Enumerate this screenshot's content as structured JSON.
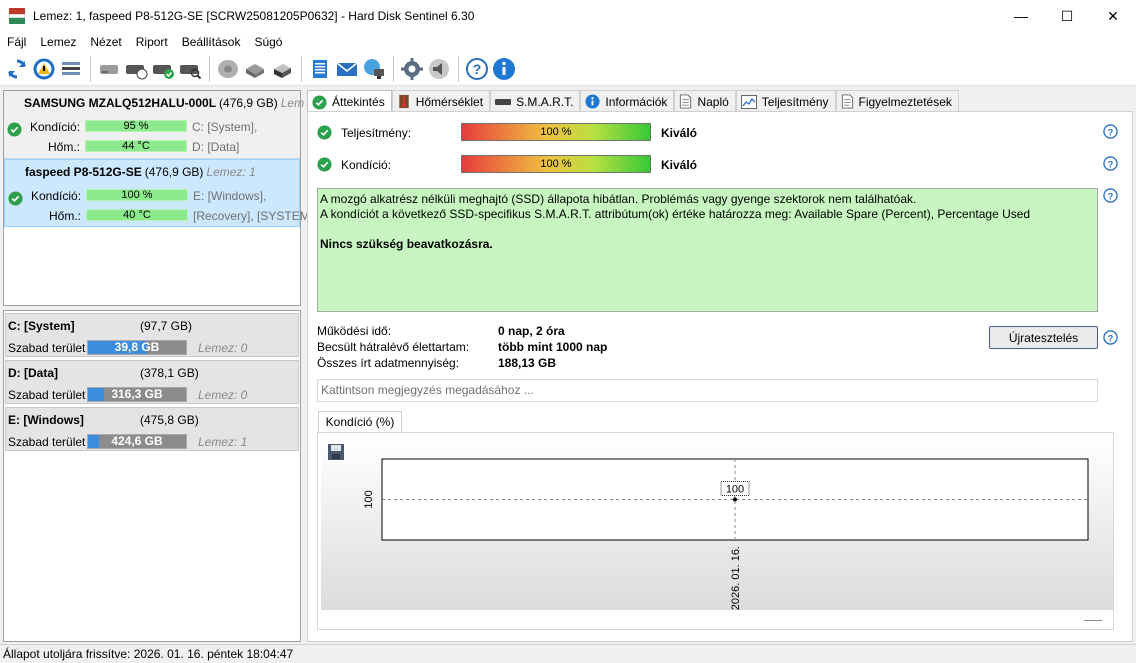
{
  "window": {
    "title": "Lemez: 1, faspeed P8-512G-SE [SCRW25081205P0632]  -  Hard Disk Sentinel 6.30",
    "minimize": "—",
    "maximize": "☐",
    "close": "✕"
  },
  "menu": [
    "Fájl",
    "Lemez",
    "Nézet",
    "Riport",
    "Beállítások",
    "Súgó"
  ],
  "disks": [
    {
      "name": "SAMSUNG MZALQ512HALU-000L",
      "size": "(476,9 GB)",
      "lemez": "Lem",
      "health_label": "Kondíció:",
      "health_value": "95 %",
      "health_fraction": 0.95,
      "temp_label": "Hőm.:",
      "temp_value": "44 °C",
      "part1": "C: [System],",
      "part2": "D: [Data]"
    },
    {
      "name": "faspeed P8-512G-SE",
      "size": "(476,9 GB)",
      "lemez": "Lemez: 1",
      "health_label": "Kondíció:",
      "health_value": "100 %",
      "health_fraction": 1.0,
      "temp_label": "Hőm.:",
      "temp_value": "40 °C",
      "part1": "E: [Windows],",
      "part2": "[Recovery],  [SYSTEM"
    }
  ],
  "volumes": [
    {
      "name": "C: [System]",
      "size": "(97,7 GB)",
      "free_label": "Szabad terület",
      "free": "39,8 GB",
      "used_fraction": 0.6,
      "lemez": "Lemez: 0"
    },
    {
      "name": "D: [Data]",
      "size": "(378,1 GB)",
      "free_label": "Szabad terület",
      "free": "316,3 GB",
      "used_fraction": 0.16,
      "lemez": "Lemez: 0"
    },
    {
      "name": "E: [Windows]",
      "size": "(475,8 GB)",
      "free_label": "Szabad terület",
      "free": "424,6 GB",
      "used_fraction": 0.11,
      "lemez": "Lemez: 1"
    }
  ],
  "tabs": [
    "Áttekintés",
    "Hőmérséklet",
    "S.M.A.R.T.",
    "Információk",
    "Napló",
    "Teljesítmény",
    "Figyelmeztetések"
  ],
  "overview": {
    "perf_label": "Teljesítmény:",
    "perf_value": "100 %",
    "perf_rating": "Kiváló",
    "cond_label": "Kondíció:",
    "cond_value": "100 %",
    "cond_rating": "Kiváló",
    "msg_line1": "A mozgó alkatrész nélküli meghajtó (SSD) állapota hibátlan. Problémás vagy gyenge szektorok nem találhatóak.",
    "msg_line2": "A kondíciót a következő SSD-specifikus S.M.A.R.T. attribútum(ok) értéke határozza meg:  Available Spare (Percent), Percentage Used",
    "msg_bold": "Nincs szükség beavatkozásra.",
    "uptime_label": "Működési idő:",
    "uptime_value": "0 nap, 2 óra",
    "life_label": "Becsült hátralévő élettartam:",
    "life_value": "több mint 1000 nap",
    "written_label": "Összes írt adatmennyiség:",
    "written_value": "188,13 GB",
    "retest_label": "Újratesztelés",
    "note_placeholder": "Kattintson megjegyzés megadásához ..."
  },
  "chart_data": {
    "type": "line",
    "title": "Kondíció  (%)",
    "x": [
      "2026. 01. 16."
    ],
    "series": [
      {
        "values": [
          100
        ]
      }
    ],
    "yticks": [
      "100"
    ],
    "data_labels": [
      "100"
    ]
  },
  "status": "Állapot utoljára frissítve: 2026. 01. 16. péntek 18:04:47"
}
